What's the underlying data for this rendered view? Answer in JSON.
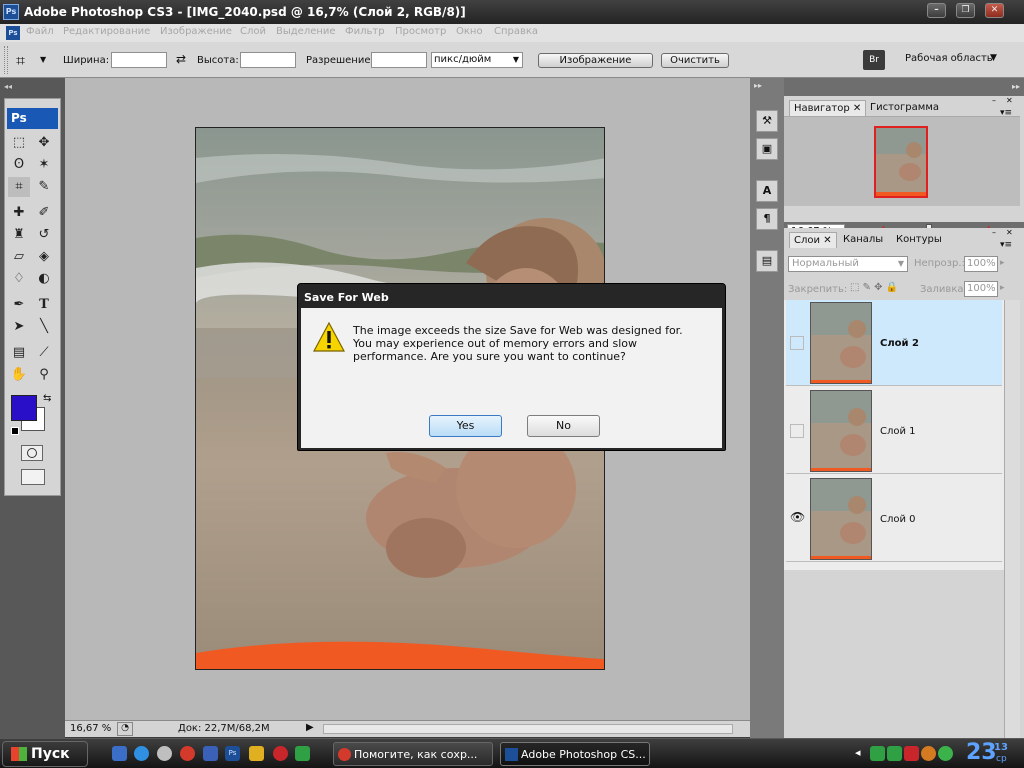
{
  "window": {
    "title": "Adobe Photoshop CS3 - [IMG_2040.psd @ 16,7% (Слой 2, RGB/8)]",
    "controls": {
      "minimize": "–",
      "restore": "❐",
      "close": "✕"
    }
  },
  "menu": [
    "Файл",
    "Редактирование",
    "Изображение",
    "Слой",
    "Выделение",
    "Фильтр",
    "Просмотр",
    "Окно",
    "Справка"
  ],
  "options_bar": {
    "width_label": "Ширина:",
    "height_label": "Высота:",
    "resolution_label": "Разрешение:",
    "units": "пикс/дюйм",
    "image_button": "Изображение",
    "clear_button": "Очистить",
    "workspace": "Рабочая область"
  },
  "toolbox": {
    "logo": "Ps"
  },
  "status": {
    "zoom": "16,67 %",
    "doc": "Док: 22,7M/68,2M"
  },
  "navigator": {
    "tabs": [
      "Навигатор",
      "Гистограмма"
    ],
    "zoom": "16.67 %"
  },
  "layers_panel": {
    "tabs": [
      "Слои",
      "Каналы",
      "Контуры"
    ],
    "blend_mode": "Нормальный",
    "opacity_label": "Непрозр.:",
    "opacity_value": "100%",
    "lock_label": "Закрепить:",
    "fill_label": "Заливка:",
    "fill_value": "100%",
    "layers": [
      {
        "name": "Слой 2",
        "selected": true,
        "visible": false
      },
      {
        "name": "Слой 1",
        "selected": false,
        "visible": false
      },
      {
        "name": "Слой 0",
        "selected": false,
        "visible": true
      }
    ]
  },
  "dialog": {
    "title": "Save For Web",
    "message": "The image exceeds the size Save for Web was designed for. You may experience out of memory errors and slow performance.  Are you sure you want to continue?",
    "yes": "Yes",
    "no": "No"
  },
  "taskbar": {
    "start": "Пуск",
    "tasks": [
      "Помогите, как сохр...",
      "Adobe Photoshop CS..."
    ],
    "clock": "23",
    "clock_small": "13",
    "clock_day": "ср"
  },
  "colors": {
    "foreground": "#2a0fc8",
    "selection": "#cde9fb",
    "accent": "#1a58b6"
  }
}
